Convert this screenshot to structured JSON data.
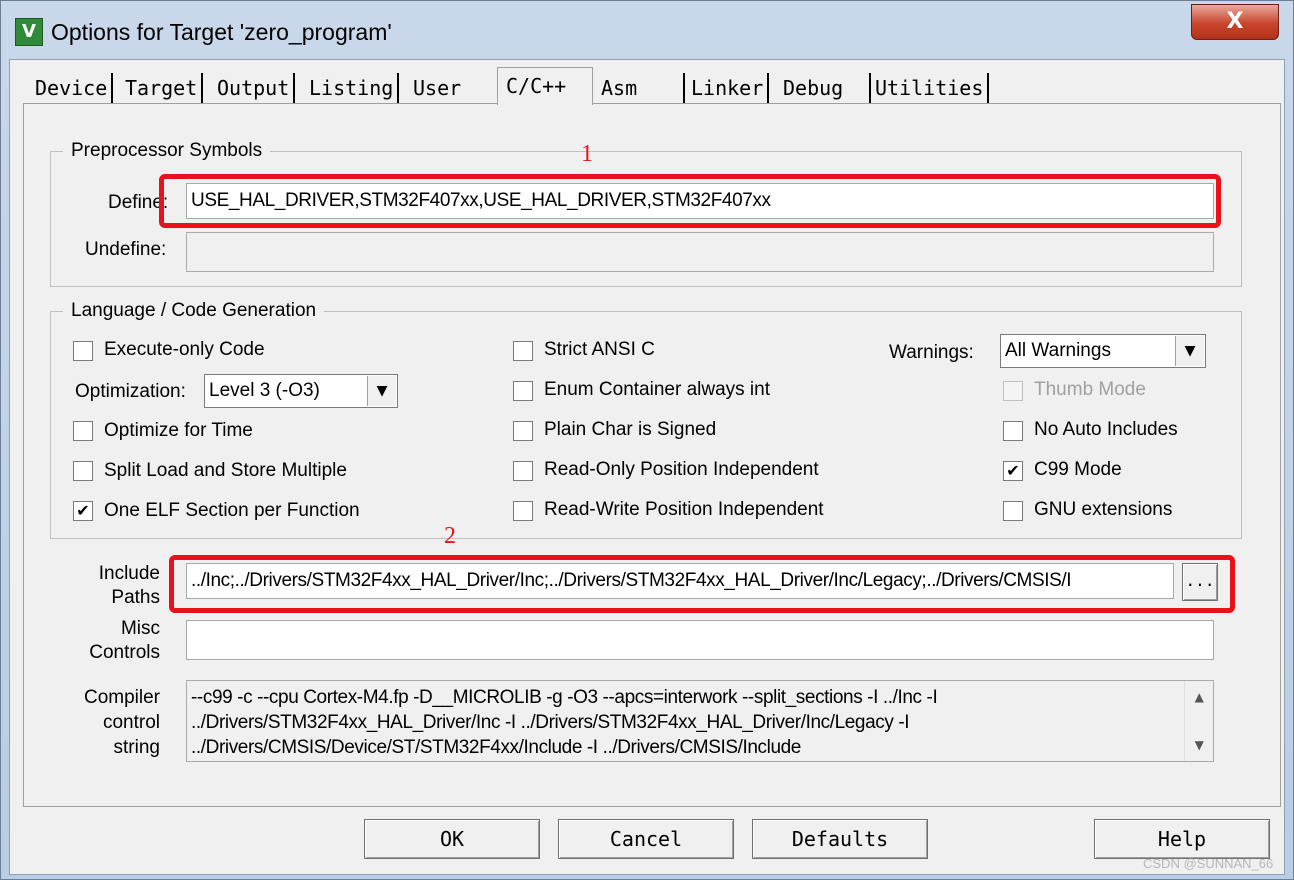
{
  "window": {
    "title": "Options for Target 'zero_program'",
    "icon_letter": "V",
    "close_glyph": "X"
  },
  "tabs": [
    {
      "label": "Device",
      "active": false
    },
    {
      "label": "Target",
      "active": false
    },
    {
      "label": "Output",
      "active": false
    },
    {
      "label": "Listing",
      "active": false
    },
    {
      "label": "User",
      "active": false
    },
    {
      "label": "C/C++",
      "active": true
    },
    {
      "label": "Asm",
      "active": false
    },
    {
      "label": "Linker",
      "active": false
    },
    {
      "label": "Debug",
      "active": false
    },
    {
      "label": "Utilities",
      "active": false
    }
  ],
  "preprocessor": {
    "group_title": "Preprocessor Symbols",
    "define_label": "Define:",
    "define_value": "USE_HAL_DRIVER,STM32F407xx,USE_HAL_DRIVER,STM32F407xx",
    "undefine_label": "Undefine:",
    "undefine_value": ""
  },
  "language": {
    "group_title": "Language / Code Generation",
    "execute_only": {
      "label": "Execute-only Code",
      "checked": false
    },
    "optimization_label": "Optimization:",
    "optimization_value": "Level 3 (-O3)",
    "optimize_time": {
      "label": "Optimize for Time",
      "checked": false
    },
    "split_load": {
      "label": "Split Load and Store Multiple",
      "checked": false
    },
    "one_elf": {
      "label": "One ELF Section per Function",
      "checked": true
    },
    "strict_ansi": {
      "label": "Strict ANSI C",
      "checked": false
    },
    "enum_container": {
      "label": "Enum Container always int",
      "checked": false
    },
    "plain_char": {
      "label": "Plain Char is Signed",
      "checked": false
    },
    "ro_pi": {
      "label": "Read-Only Position Independent",
      "checked": false
    },
    "rw_pi": {
      "label": "Read-Write Position Independent",
      "checked": false
    },
    "warnings_label": "Warnings:",
    "warnings_value": "All Warnings",
    "thumb_mode": {
      "label": "Thumb Mode",
      "checked": false,
      "disabled": true
    },
    "no_auto_includes": {
      "label": "No Auto Includes",
      "checked": false
    },
    "c99_mode": {
      "label": "C99 Mode",
      "checked": true
    },
    "gnu_extensions": {
      "label": "GNU extensions",
      "checked": false
    }
  },
  "include": {
    "label_line1": "Include",
    "label_line2": "Paths",
    "value": "../Inc;../Drivers/STM32F4xx_HAL_Driver/Inc;../Drivers/STM32F4xx_HAL_Driver/Inc/Legacy;../Drivers/CMSIS/I",
    "browse_label": "..."
  },
  "misc": {
    "label_line1": "Misc",
    "label_line2": "Controls",
    "value": ""
  },
  "compiler": {
    "label_line1": "Compiler",
    "label_line2": "control",
    "label_line3": "string",
    "lines": [
      "--c99 -c --cpu Cortex-M4.fp -D__MICROLIB -g -O3 --apcs=interwork --split_sections -I ../Inc -I",
      "../Drivers/STM32F4xx_HAL_Driver/Inc -I ../Drivers/STM32F4xx_HAL_Driver/Inc/Legacy -I",
      "../Drivers/CMSIS/Device/ST/STM32F4xx/Include -I ../Drivers/CMSIS/Include"
    ]
  },
  "annotations": {
    "one": "1",
    "two": "2"
  },
  "buttons": {
    "ok": "OK",
    "cancel": "Cancel",
    "defaults": "Defaults",
    "help": "Help"
  },
  "watermark": "CSDN @SUNNAN_66",
  "icons": {
    "checkmark": "✔",
    "dropdown": "▼",
    "scroll_up": "▲",
    "scroll_down": "▼"
  },
  "colors": {
    "annotation_red": "#e8121a",
    "title_bar": "#c9d8ea",
    "close_red": "#c9452d"
  }
}
